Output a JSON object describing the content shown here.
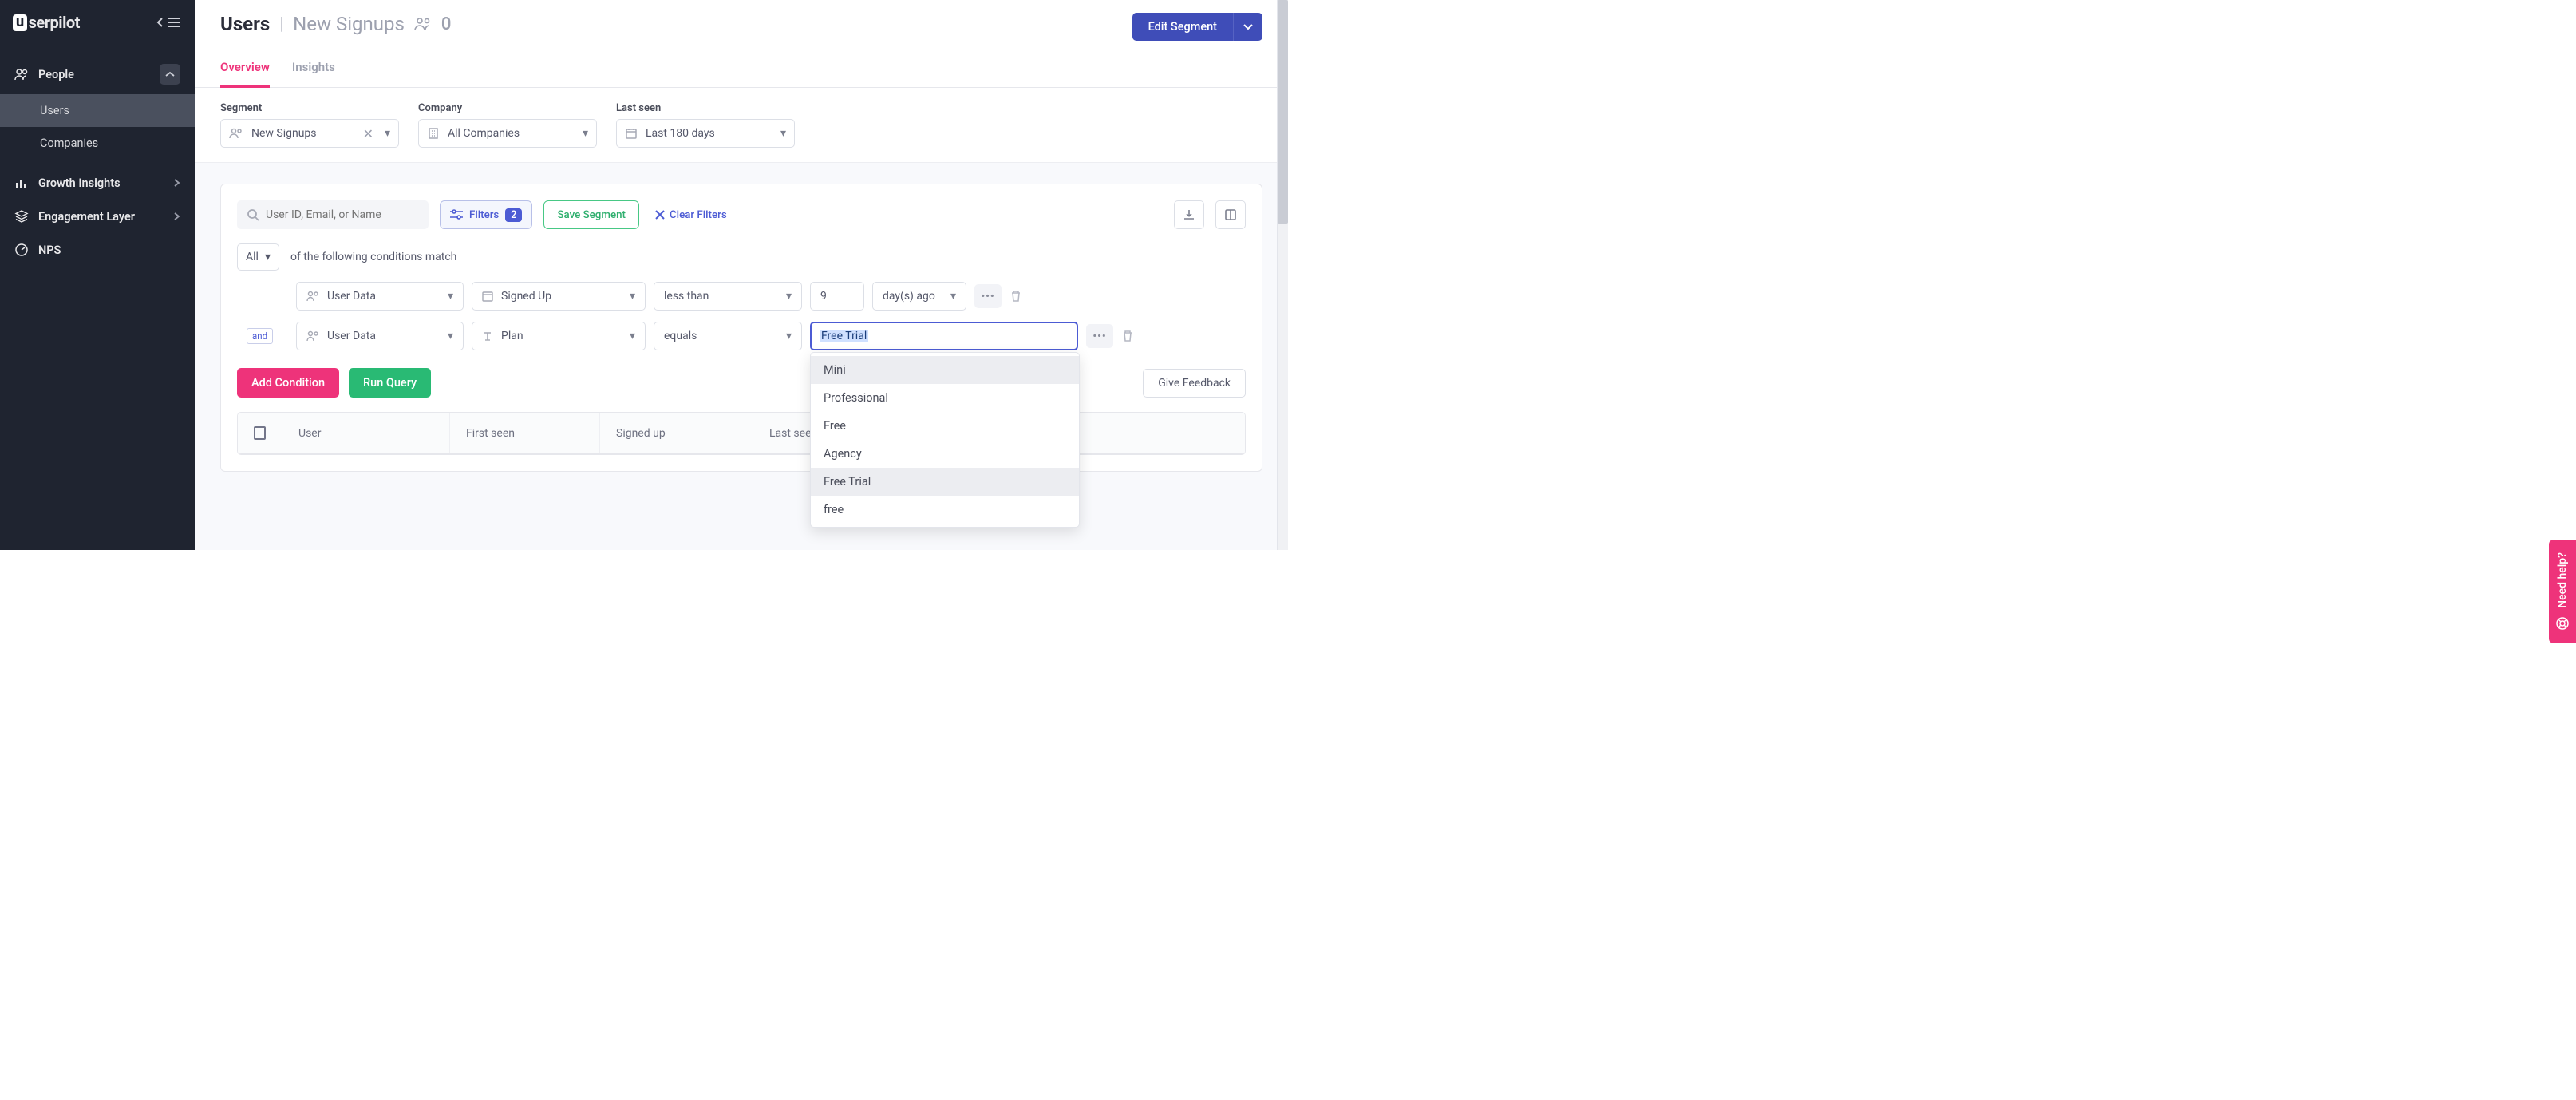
{
  "brand": "serpilot",
  "sidebar": {
    "sections": [
      {
        "label": "People",
        "open": true,
        "children": [
          {
            "label": "Users",
            "active": true
          },
          {
            "label": "Companies",
            "active": false
          }
        ]
      },
      {
        "label": "Growth Insights",
        "open": false
      },
      {
        "label": "Engagement Layer",
        "open": false
      },
      {
        "label": "NPS",
        "open": false
      }
    ]
  },
  "header": {
    "title": "Users",
    "subtitle": "New Signups",
    "count": "0",
    "edit_label": "Edit Segment"
  },
  "tabs": [
    {
      "label": "Overview",
      "active": true
    },
    {
      "label": "Insights",
      "active": false
    }
  ],
  "filter_bar": {
    "segment_label": "Segment",
    "segment_value": "New Signups",
    "company_label": "Company",
    "company_value": "All Companies",
    "lastseen_label": "Last seen",
    "lastseen_value": "Last 180 days"
  },
  "toolbar": {
    "search_placeholder": "User ID, Email, or Name",
    "filters_label": "Filters",
    "filters_count": "2",
    "save_segment": "Save Segment",
    "clear_filters": "Clear Filters"
  },
  "conditions": {
    "match_mode": "All",
    "match_text": "of the following conditions match",
    "connector": "and",
    "rules": [
      {
        "type": "User Data",
        "field": "Signed Up",
        "op": "less than",
        "value": "9",
        "unit": "day(s) ago"
      },
      {
        "type": "User Data",
        "field": "Plan",
        "op": "equals",
        "value": "Free Trial"
      }
    ],
    "dropdown_options": [
      "Mini",
      "Professional",
      "Free",
      "Agency",
      "Free Trial",
      "free"
    ]
  },
  "actions": {
    "add_condition": "Add Condition",
    "run_query": "Run Query",
    "give_feedback": "Give Feedback"
  },
  "table": {
    "columns": [
      "User",
      "First seen",
      "Signed up",
      "Last seen"
    ]
  },
  "help": "Need help?"
}
